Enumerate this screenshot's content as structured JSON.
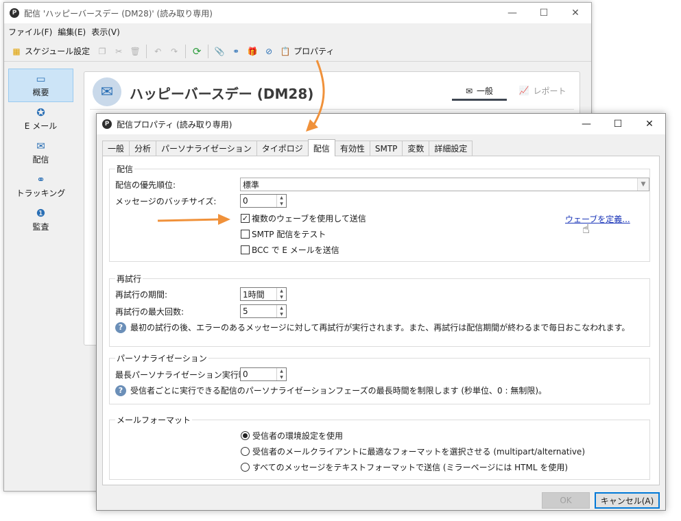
{
  "main_window": {
    "title": "配信 'ハッピーバースデー (DM28)' (読み取り専用)",
    "controls": {
      "minimize": "—",
      "maximize": "☐",
      "close": "✕"
    },
    "menu": [
      "ファイル(F)",
      "編集(E)",
      "表示(V)"
    ],
    "toolbar": {
      "schedule_label": "スケジュール設定",
      "properties_label": "プロパティ"
    },
    "nav": [
      {
        "label": "概要",
        "icon": "overview-icon"
      },
      {
        "label": "E メール",
        "icon": "email-channel-icon"
      },
      {
        "label": "配信",
        "icon": "delivery-icon"
      },
      {
        "label": "トラッキング",
        "icon": "tracking-icon"
      },
      {
        "label": "監査",
        "icon": "audit-icon"
      }
    ],
    "content": {
      "title": "ハッピーバースデー (DM28)",
      "tab_general": "一般",
      "tab_report": "レポート"
    }
  },
  "dialog": {
    "title": "配信プロパティ (読み取り専用)",
    "controls": {
      "minimize": "—",
      "maximize": "☐",
      "close": "✕"
    },
    "tabs": [
      "一般",
      "分析",
      "パーソナライゼーション",
      "タイポロジ",
      "配信",
      "有効性",
      "SMTP",
      "変数",
      "詳細設定"
    ],
    "active_tab": "配信",
    "delivery_group": {
      "title": "配信",
      "priority_label": "配信の優先順位:",
      "priority_value": "標準",
      "batch_label": "メッセージのバッチサイズ:",
      "batch_value": "0",
      "multiple_waves_label": "複数のウェーブを使用して送信",
      "multiple_waves_checked": true,
      "define_waves_link": "ウェーブを定義...",
      "smtp_test_label": "SMTP 配信をテスト",
      "smtp_test_checked": false,
      "bcc_label": "BCC で E メールを送信",
      "bcc_checked": false
    },
    "retry_group": {
      "title": "再試行",
      "period_label": "再試行の期間:",
      "period_value": "1時間",
      "max_label": "再試行の最大回数:",
      "max_value": "5",
      "help": "最初の試行の後、エラーのあるメッセージに対して再試行が実行されます。また、再試行は配信期間が終わるまで毎日おこなわれます。"
    },
    "personalization_group": {
      "title": "パーソナライゼーション",
      "max_time_label": "最長パーソナライゼーション実行時間:",
      "max_time_value": "0",
      "help": "受信者ごとに実行できる配信のパーソナライゼーションフェーズの最長時間を制限します (秒単位、0 : 無制限)。"
    },
    "mail_format_group": {
      "title": "メールフォーマット",
      "options": [
        "受信者の環境設定を使用",
        "受信者のメールクライアントに最適なフォーマットを選択させる (multipart/alternative)",
        "すべてのメッセージをテキストフォーマットで送信 (ミラーページには HTML を使用)"
      ],
      "selected_index": 0
    },
    "buttons": {
      "ok": "OK",
      "cancel": "キャンセル(A)"
    }
  },
  "colors": {
    "arrow": "#f0913a",
    "link": "#1a35b8",
    "selection": "#cce4f7"
  }
}
